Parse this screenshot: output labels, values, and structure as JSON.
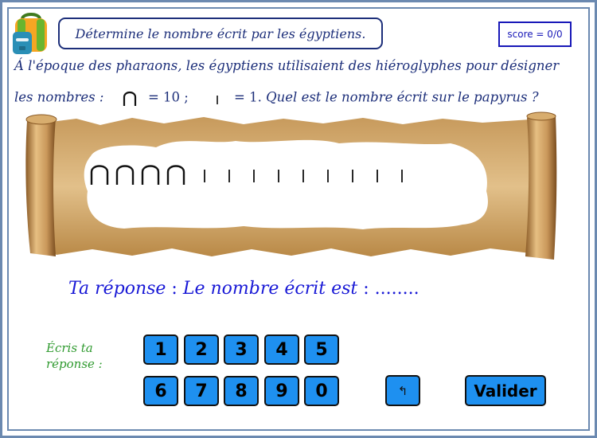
{
  "header": {
    "title": "Détermine le nombre écrit par les égyptiens.",
    "score": "score = 0/0"
  },
  "intro": {
    "line1": "Á l'époque des pharaons, les égyptiens utilisaient des hiéroglyphes pour désigner",
    "line2_prefix": "les nombres :",
    "ten_value": "= 10 ;",
    "one_value": "= 1.",
    "question": "Quel est le nombre écrit sur le papyrus ?"
  },
  "papyrus": {
    "tens_count": 4,
    "units_count": 9
  },
  "answer": {
    "label": "Ta réponse",
    "sep": ":",
    "sentence": "Le nombre écrit est",
    "sep2": ":",
    "dots": "........"
  },
  "keypad": {
    "prompt_line1": "Écris ta",
    "prompt_line2": "réponse :",
    "keys": [
      "1",
      "2",
      "3",
      "4",
      "5",
      "6",
      "7",
      "8",
      "9",
      "0"
    ],
    "backspace": "↰",
    "submit": "Valider"
  },
  "icons": {
    "backpack": "backpack-icon",
    "ten": "hieroglyph-ten-icon",
    "one": "hieroglyph-one-icon"
  },
  "colors": {
    "title_text": "#1d2f7a",
    "answer_text": "#1818d6",
    "prompt_text": "#2f9a2f",
    "key_fill": "#1e90f0",
    "frame": "#6b89b0"
  }
}
